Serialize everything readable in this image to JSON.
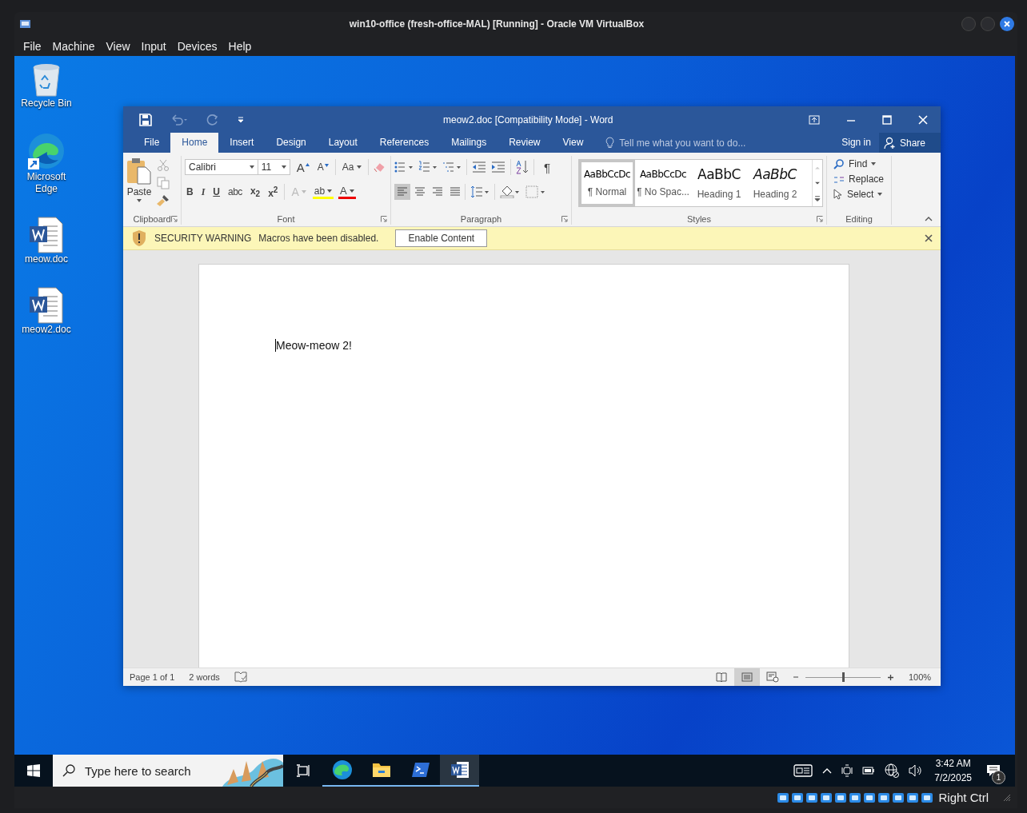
{
  "vm_window": {
    "title": "win10-office (fresh-office-MAL) [Running] - Oracle VM VirtualBox",
    "menu": [
      "File",
      "Machine",
      "View",
      "Input",
      "Devices",
      "Help"
    ],
    "host_key": "Right Ctrl"
  },
  "desktop_icons": [
    {
      "label": "Recycle Bin",
      "kind": "recycle-bin"
    },
    {
      "label": "Microsoft Edge",
      "kind": "edge"
    },
    {
      "label": "meow.doc",
      "kind": "word-doc"
    },
    {
      "label": "meow2.doc",
      "kind": "word-doc"
    }
  ],
  "word": {
    "title": "meow2.doc [Compatibility Mode] - Word",
    "tabs": [
      {
        "label": "File",
        "selected": false
      },
      {
        "label": "Home",
        "selected": true
      },
      {
        "label": "Insert",
        "selected": false
      },
      {
        "label": "Design",
        "selected": false
      },
      {
        "label": "Layout",
        "selected": false
      },
      {
        "label": "References",
        "selected": false
      },
      {
        "label": "Mailings",
        "selected": false
      },
      {
        "label": "Review",
        "selected": false
      },
      {
        "label": "View",
        "selected": false
      }
    ],
    "tell_me": {
      "placeholder": "Tell me what you want to do..."
    },
    "sign_in": "Sign in",
    "share": "Share",
    "clipboard": {
      "paste": "Paste",
      "label": "Clipboard"
    },
    "font": {
      "label": "Font",
      "family": "Calibri",
      "size": "11",
      "grow": "A",
      "shrink": "A",
      "case": "Aa",
      "format_buttons": [
        {
          "kind": "bold",
          "label": "B"
        },
        {
          "kind": "italic",
          "label": "I"
        },
        {
          "kind": "underline",
          "label": "U"
        },
        {
          "kind": "strike",
          "label": "abc"
        },
        {
          "kind": "subscript",
          "label": "x$_{2}$"
        },
        {
          "kind": "superscript",
          "label": "x$^{2}$"
        }
      ],
      "effects": "A",
      "highlight": "ab",
      "font_color": "A"
    },
    "paragraph": {
      "label": "Paragraph",
      "pilcrow": "¶",
      "alignment": [
        {
          "kind": "left",
          "selected": true
        },
        {
          "kind": "center",
          "selected": false
        },
        {
          "kind": "right",
          "selected": false
        },
        {
          "kind": "justify",
          "selected": false
        }
      ]
    },
    "styles": {
      "label": "Styles",
      "items": [
        {
          "sample": "AaBbCcDc",
          "name": "¶ Normal",
          "kind": "normal",
          "selected": true
        },
        {
          "sample": "AaBbCcDc",
          "name": "¶ No Spac...",
          "kind": "no-spacing",
          "selected": false
        },
        {
          "sample": "AaBbC",
          "name": "Heading 1",
          "kind": "heading1",
          "selected": false
        },
        {
          "sample": "AaBbC",
          "name": "Heading 2",
          "kind": "heading2",
          "selected": false
        }
      ]
    },
    "editing": {
      "label": "Editing",
      "find": "Find",
      "replace": "Replace",
      "select": "Select"
    },
    "warning": {
      "title": "SECURITY WARNING",
      "message": "Macros have been disabled.",
      "button": "Enable Content"
    },
    "document": {
      "text": "Meow-meow 2!"
    },
    "status": {
      "page": "Page 1 of 1",
      "words": "2 words",
      "views": [
        {
          "kind": "read",
          "selected": false
        },
        {
          "kind": "print",
          "selected": true
        },
        {
          "kind": "web",
          "selected": false
        }
      ],
      "zoom": {
        "level": 0.5,
        "reading": "100%"
      }
    }
  },
  "taskbar": {
    "search": {
      "placeholder": "Type here to search"
    },
    "apps": [
      {
        "kind": "task-view",
        "running": false,
        "selected": false
      },
      {
        "kind": "edge",
        "running": true,
        "selected": false
      },
      {
        "kind": "explorer",
        "running": true,
        "selected": false
      },
      {
        "kind": "terminal",
        "running": true,
        "selected": false
      },
      {
        "kind": "word",
        "running": true,
        "selected": true
      }
    ],
    "time": "3:42 AM",
    "date": "7/2/2025",
    "notifications": "1"
  }
}
